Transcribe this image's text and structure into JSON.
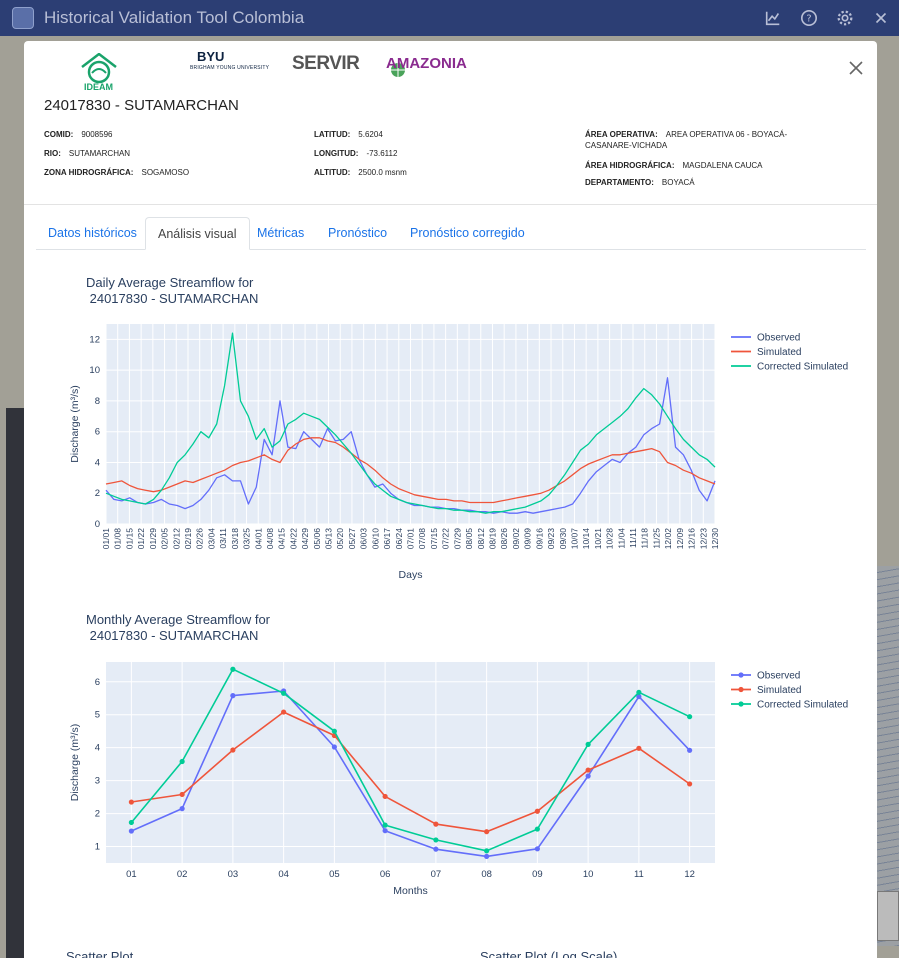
{
  "app": {
    "title": "Historical Validation Tool Colombia",
    "tools": [
      {
        "icon": "chart-icon",
        "label": ""
      },
      {
        "icon": "help-icon",
        "label": ""
      },
      {
        "icon": "gear-icon",
        "label": ""
      },
      {
        "icon": "close-icon",
        "label": ""
      }
    ]
  },
  "modal": {
    "logos": {
      "ideam": "IDEAM",
      "byu": "BYU",
      "byu_sub": "BRIGHAM YOUNG UNIVERSITY",
      "servir": "SERVIR",
      "amazonia": "AMAZONIA"
    },
    "station_title": "24017830 - SUTAMARCHAN",
    "info": {
      "col1": [
        {
          "label": "COMID:",
          "value": "9008596"
        },
        {
          "label": "RIO:",
          "value": "SUTAMARCHAN"
        },
        {
          "label": "ZONA HIDROGRÁFICA:",
          "value": "SOGAMOSO"
        }
      ],
      "col2": [
        {
          "label": "LATITUD:",
          "value": "5.6204"
        },
        {
          "label": "LONGITUD:",
          "value": "-73.6112"
        },
        {
          "label": "ALTITUD:",
          "value": "2500.0 msnm"
        }
      ],
      "col3": [
        {
          "label": "ÁREA OPERATIVA:",
          "value": "AREA OPERATIVA 06 - BOYACÁ-CASANARE-VICHADA"
        },
        {
          "label": "ÁREA HIDROGRÁFICA:",
          "value": "MAGDALENA CAUCA"
        },
        {
          "label": "DEPARTAMENTO:",
          "value": "BOYACÁ"
        }
      ]
    },
    "tabs": [
      "Datos históricos",
      "Análisis visual",
      "Métricas",
      "Pronóstico",
      "Pronóstico corregido"
    ],
    "active_tab": 1,
    "scatter_titles": [
      "Scatter Plot",
      "Scatter Plot (Log Scale)"
    ]
  },
  "colors": {
    "observed": "#636efa",
    "simulated": "#ef553b",
    "corrected": "#00cc96",
    "plot_bg": "#e5ecf6",
    "axis_text": "#2a3f5f"
  },
  "chart_data": [
    {
      "type": "line",
      "title": "Daily Average Streamflow for\n 24017830 - SUTAMARCHAN",
      "xlabel": "Days",
      "ylabel": "Discharge (m³/s)",
      "ylim": [
        0,
        13
      ],
      "yticks": [
        0,
        2,
        4,
        6,
        8,
        10,
        12
      ],
      "legend": "top-right",
      "x_ticks": [
        "01/01",
        "01/08",
        "01/15",
        "01/22",
        "01/29",
        "02/05",
        "02/12",
        "02/19",
        "02/26",
        "03/04",
        "03/11",
        "03/18",
        "03/25",
        "04/01",
        "04/08",
        "04/15",
        "04/22",
        "04/29",
        "05/06",
        "05/13",
        "05/20",
        "05/27",
        "06/03",
        "06/10",
        "06/17",
        "06/24",
        "07/01",
        "07/08",
        "07/15",
        "07/22",
        "07/29",
        "08/05",
        "08/12",
        "08/19",
        "08/26",
        "09/02",
        "09/09",
        "09/16",
        "09/23",
        "09/30",
        "10/07",
        "10/14",
        "10/21",
        "10/28",
        "11/04",
        "11/11",
        "11/18",
        "11/25",
        "12/02",
        "12/09",
        "12/16",
        "12/23",
        "12/30"
      ],
      "series": [
        {
          "name": "Observed",
          "values": [
            2.2,
            1.6,
            1.5,
            1.7,
            1.4,
            1.3,
            1.4,
            1.6,
            1.3,
            1.2,
            1.0,
            1.2,
            1.6,
            2.2,
            3.0,
            3.2,
            2.8,
            2.8,
            1.3,
            2.4,
            5.5,
            4.5,
            8.0,
            5.0,
            4.9,
            6.0,
            5.5,
            5.0,
            6.2,
            5.4,
            5.5,
            6.0,
            4.2,
            3.2,
            2.4,
            2.6,
            2.0,
            1.6,
            1.4,
            1.2,
            1.2,
            1.1,
            1.1,
            1.0,
            1.0,
            0.9,
            0.9,
            0.8,
            0.8,
            0.7,
            0.8,
            0.7,
            0.7,
            0.8,
            0.7,
            0.8,
            0.9,
            1.0,
            1.1,
            1.3,
            2.0,
            2.8,
            3.4,
            3.8,
            4.2,
            4.0,
            4.6,
            5.0,
            5.8,
            6.2,
            6.5,
            9.5,
            5.0,
            4.5,
            3.5,
            2.2,
            1.5,
            2.8
          ]
        },
        {
          "name": "Simulated",
          "values": [
            2.6,
            2.7,
            2.8,
            2.5,
            2.3,
            2.2,
            2.1,
            2.2,
            2.4,
            2.6,
            2.8,
            2.7,
            2.9,
            3.1,
            3.3,
            3.5,
            3.8,
            4.0,
            4.1,
            4.3,
            4.5,
            4.2,
            4.0,
            4.8,
            5.2,
            5.5,
            5.6,
            5.6,
            5.4,
            5.3,
            5.0,
            4.6,
            4.2,
            3.9,
            3.5,
            3.0,
            2.6,
            2.3,
            2.1,
            1.9,
            1.8,
            1.7,
            1.6,
            1.6,
            1.5,
            1.5,
            1.4,
            1.4,
            1.4,
            1.4,
            1.5,
            1.6,
            1.7,
            1.8,
            1.9,
            2.0,
            2.2,
            2.5,
            2.8,
            3.2,
            3.6,
            3.9,
            4.1,
            4.3,
            4.5,
            4.5,
            4.6,
            4.7,
            4.8,
            4.9,
            4.7,
            4.0,
            3.8,
            3.5,
            3.3,
            3.0,
            2.8,
            2.6
          ]
        },
        {
          "name": "Corrected Simulated",
          "values": [
            2.0,
            1.8,
            1.6,
            1.5,
            1.4,
            1.3,
            1.6,
            2.2,
            3.0,
            4.0,
            4.5,
            5.2,
            6.0,
            5.6,
            6.5,
            9.0,
            12.4,
            8.0,
            7.0,
            5.5,
            6.2,
            5.0,
            5.4,
            6.5,
            6.8,
            7.2,
            7.0,
            6.8,
            6.3,
            5.8,
            5.2,
            4.6,
            3.9,
            3.2,
            2.6,
            2.2,
            1.8,
            1.6,
            1.4,
            1.3,
            1.2,
            1.1,
            1.0,
            1.0,
            0.9,
            0.9,
            0.8,
            0.8,
            0.7,
            0.8,
            0.8,
            0.9,
            1.0,
            1.1,
            1.3,
            1.5,
            1.9,
            2.5,
            3.2,
            4.0,
            4.8,
            5.2,
            5.8,
            6.2,
            6.6,
            7.0,
            7.5,
            8.2,
            8.8,
            8.4,
            7.8,
            7.0,
            6.2,
            5.5,
            5.0,
            4.5,
            4.2,
            3.7
          ]
        }
      ]
    },
    {
      "type": "line",
      "title": "Monthly Average Streamflow for\n 24017830 - SUTAMARCHAN",
      "xlabel": "Months",
      "ylabel": "Discharge (m³/s)",
      "ylim": [
        0.5,
        6.6
      ],
      "yticks": [
        1,
        2,
        3,
        4,
        5,
        6
      ],
      "legend": "top-right",
      "categories": [
        "01",
        "02",
        "03",
        "04",
        "05",
        "06",
        "07",
        "08",
        "09",
        "10",
        "11",
        "12"
      ],
      "series": [
        {
          "name": "Observed",
          "values": [
            1.47,
            2.15,
            5.58,
            5.72,
            4.02,
            1.48,
            0.92,
            0.7,
            0.93,
            3.14,
            5.55,
            3.92
          ]
        },
        {
          "name": "Simulated",
          "values": [
            2.35,
            2.58,
            3.93,
            5.08,
            4.37,
            2.52,
            1.68,
            1.45,
            2.07,
            3.32,
            3.98,
            2.9
          ]
        },
        {
          "name": "Corrected Simulated",
          "values": [
            1.73,
            3.58,
            6.38,
            5.65,
            4.5,
            1.65,
            1.2,
            0.87,
            1.53,
            4.1,
            5.68,
            4.94
          ]
        }
      ]
    }
  ]
}
